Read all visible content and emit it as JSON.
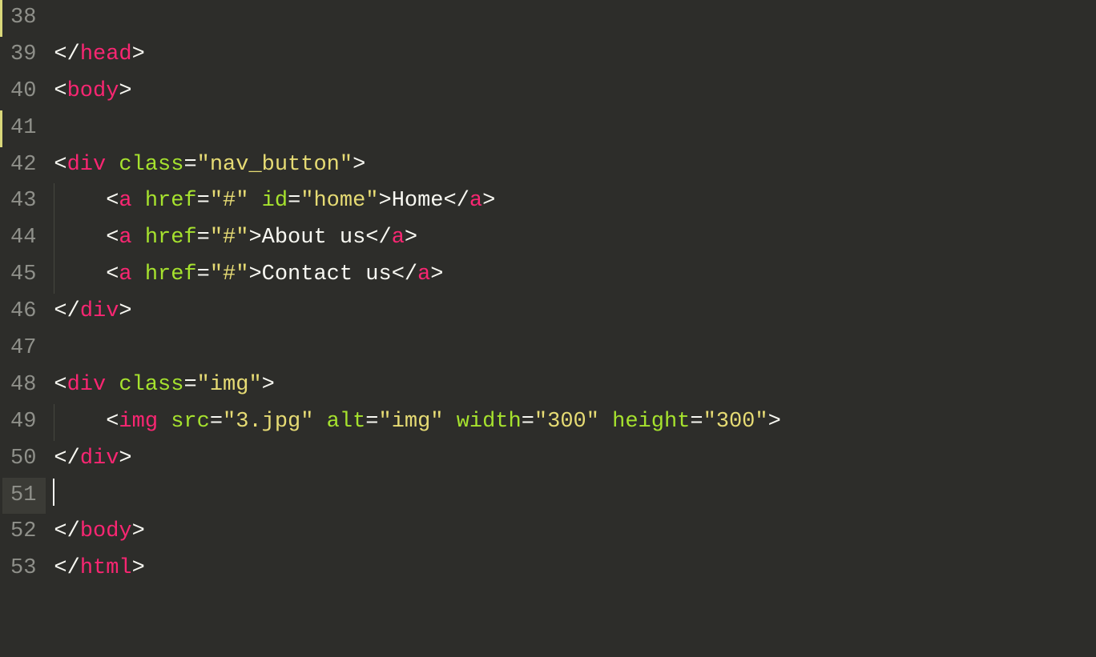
{
  "lines": [
    {
      "num": 38,
      "mark": true
    },
    {
      "num": 39,
      "mark": false
    },
    {
      "num": 40,
      "mark": false
    },
    {
      "num": 41,
      "mark": true
    },
    {
      "num": 42,
      "mark": false
    },
    {
      "num": 43,
      "mark": false
    },
    {
      "num": 44,
      "mark": false
    },
    {
      "num": 45,
      "mark": false
    },
    {
      "num": 46,
      "mark": false
    },
    {
      "num": 47,
      "mark": false
    },
    {
      "num": 48,
      "mark": false
    },
    {
      "num": 49,
      "mark": false
    },
    {
      "num": 50,
      "mark": false
    },
    {
      "num": 51,
      "mark": false,
      "active": true
    },
    {
      "num": 52,
      "mark": false
    },
    {
      "num": 53,
      "mark": false
    }
  ],
  "code": {
    "l39": {
      "tag_close": "head"
    },
    "l40": {
      "tag_open": "body"
    },
    "l42": {
      "tag": "div",
      "attr_class": "class",
      "val_class": "nav_button"
    },
    "l43": {
      "tag": "a",
      "attr_href": "href",
      "val_href": "#",
      "attr_id": "id",
      "val_id": "home",
      "text": "Home"
    },
    "l44": {
      "tag": "a",
      "attr_href": "href",
      "val_href": "#",
      "text": "About us"
    },
    "l45": {
      "tag": "a",
      "attr_href": "href",
      "val_href": "#",
      "text": "Contact us"
    },
    "l46": {
      "tag_close": "div"
    },
    "l48": {
      "tag": "div",
      "attr_class": "class",
      "val_class": "img"
    },
    "l49": {
      "tag": "img",
      "attr_src": "src",
      "val_src": "3.jpg",
      "attr_alt": "alt",
      "val_alt": "img",
      "attr_w": "width",
      "val_w": "300",
      "attr_h": "height",
      "val_h": "300"
    },
    "l50": {
      "tag_close": "div"
    },
    "l52": {
      "tag_close": "body"
    },
    "l53": {
      "tag_close": "html"
    }
  },
  "punct": {
    "lt": "<",
    "gt": ">",
    "lts": "</",
    "eq": "=",
    "q": "\""
  }
}
